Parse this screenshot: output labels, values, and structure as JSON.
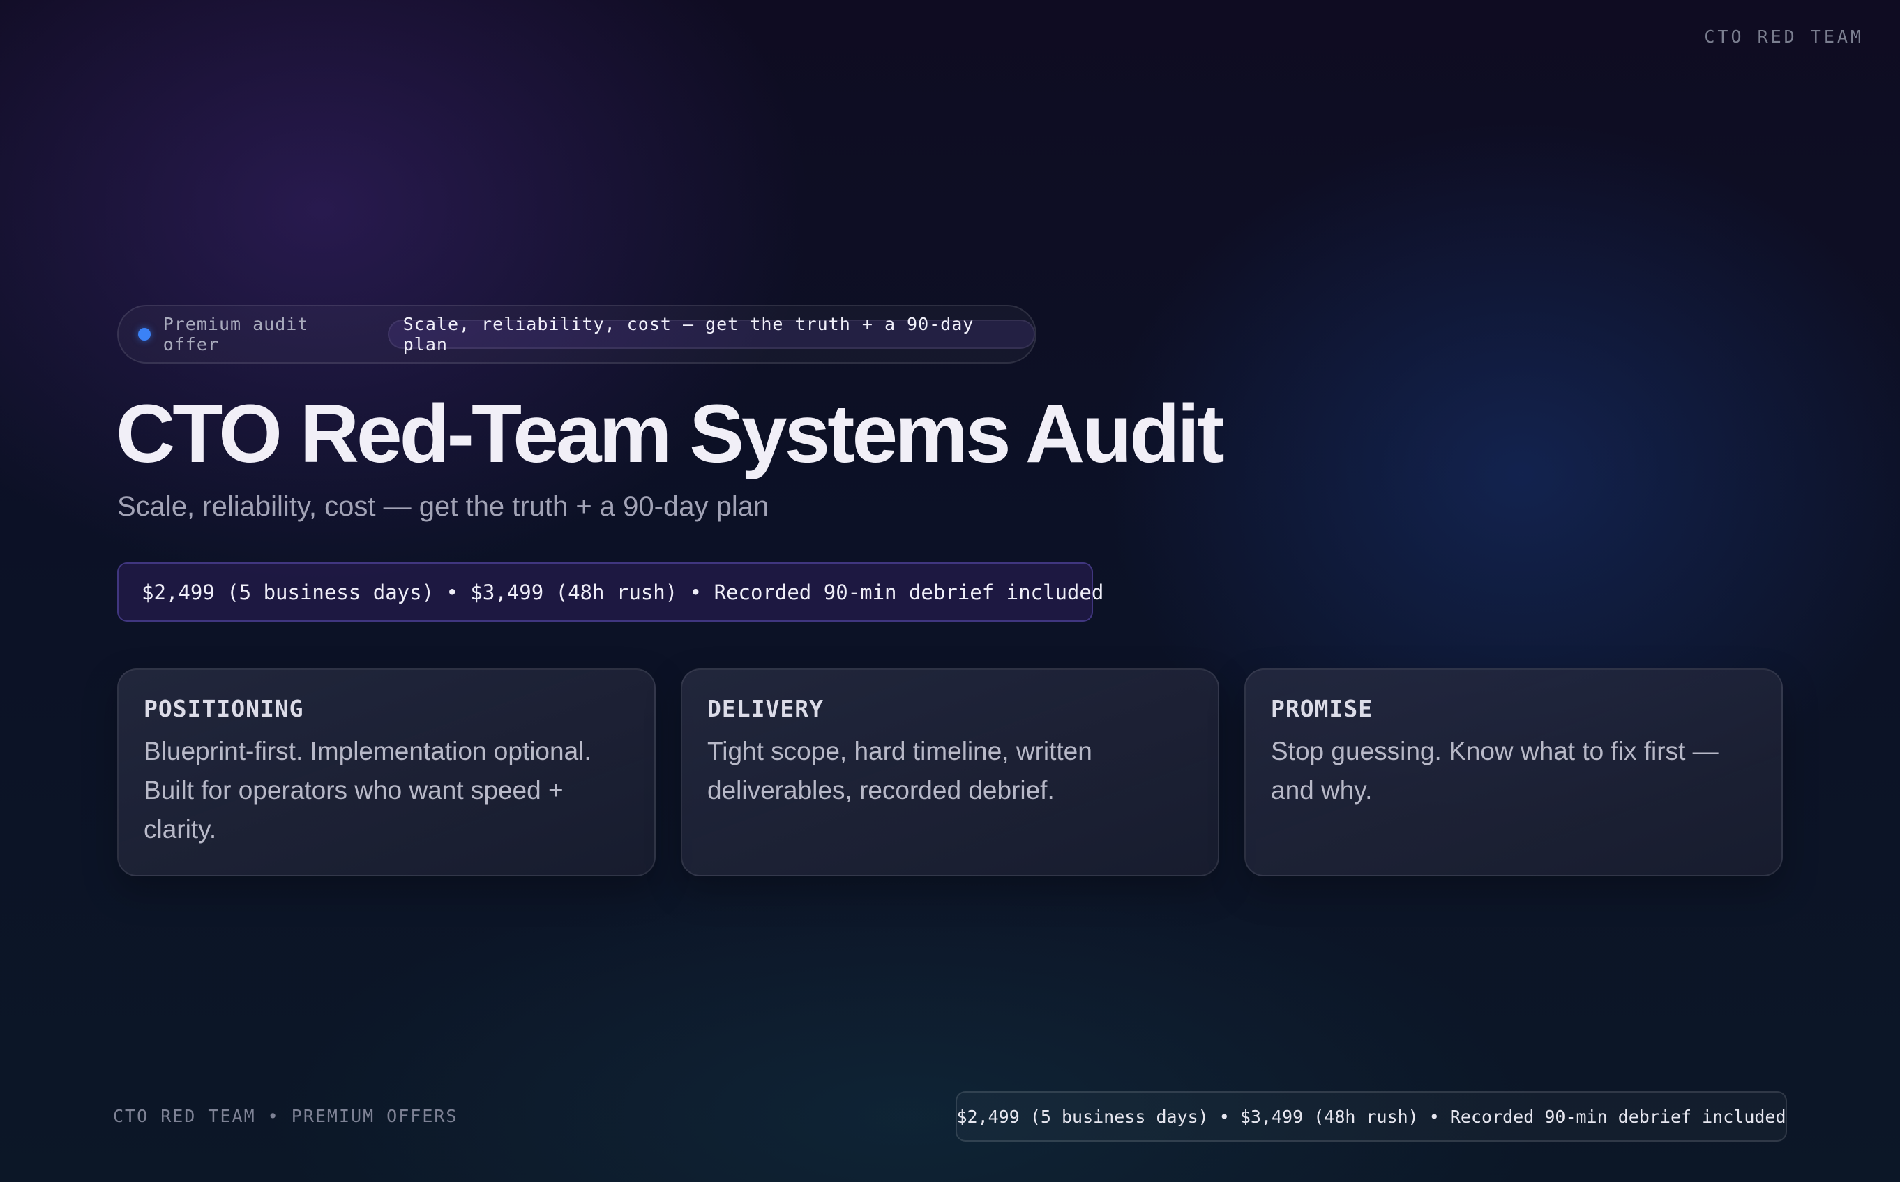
{
  "brand": {
    "top_label": "CTO RED TEAM"
  },
  "hero": {
    "offer_label": "Premium audit offer",
    "tagline_pill": "Scale, reliability, cost — get the truth + a 90-day plan",
    "title": "CTO Red-Team Systems Audit",
    "subtitle": "Scale, reliability, cost — get the truth + a 90-day plan",
    "price_line": "$2,499 (5 business days) • $3,499 (48h rush) • Recorded 90-min debrief included"
  },
  "cards": [
    {
      "heading": "POSITIONING",
      "body": "Blueprint-first. Implementation optional. Built for operators who want speed + clarity."
    },
    {
      "heading": "DELIVERY",
      "body": "Tight scope, hard timeline, written deliverables, recorded debrief."
    },
    {
      "heading": "PROMISE",
      "body": "Stop guessing. Know what to fix first — and why."
    }
  ],
  "footer": {
    "left_label": "CTO RED TEAM • PREMIUM OFFERS",
    "price_line": "$2,499 (5 business days) • $3,499 (48h rush) • Recorded 90-min debrief included"
  },
  "colors": {
    "accent_dot": "#3b82f6",
    "background_top": "#0f0c22",
    "background_bottom": "#0c1727",
    "title_text": "#f1eff7"
  },
  "icons": {
    "status_dot": "status-dot-icon"
  }
}
